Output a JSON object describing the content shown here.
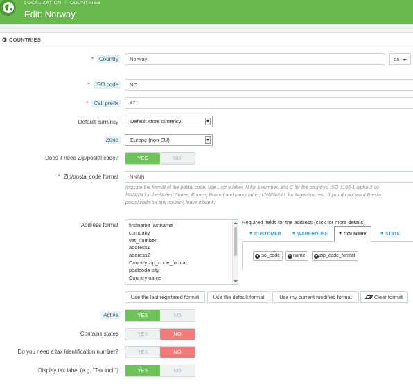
{
  "header": {
    "breadcrumb": [
      "LOCALIZATION",
      "COUNTRIES"
    ],
    "title": "Edit: Norway",
    "accent_color": "#6ab94e"
  },
  "panel": {
    "title": "COUNTRIES"
  },
  "form": {
    "country": {
      "label": "Country",
      "value": "Norway",
      "lang": "da"
    },
    "iso_code": {
      "label": "ISO code",
      "value": "NO"
    },
    "call_prefix": {
      "label": "Call prefix",
      "value": "47"
    },
    "default_currency": {
      "label": "Default currency",
      "selected": "Default store currency"
    },
    "zone": {
      "label": "Zone",
      "selected": "Europe (non-EU)"
    },
    "need_zip": {
      "label": "Does it need Zip/postal code?",
      "yes": "YES",
      "no": "NO",
      "value": "yes"
    },
    "zip_format": {
      "label": "Zip/postal code format",
      "value": "NNNN",
      "help_lines": [
        "Indicate the format of the postal code: use L for a letter, N for a number, and C for the country's ISO 3166-1 alpha-2 co",
        "NNNNN for the United States, France, Poland and many other; LNNNNLLL for Argentina, etc. If you do not want Presta",
        "postal code for this country, leave it blank."
      ]
    },
    "address_format": {
      "label": "Address format",
      "lines": [
        "firstname lastname",
        "company",
        "vat_number",
        "address1",
        "address2",
        "Country:zip_code_format",
        "postcode city",
        "Country:name"
      ],
      "required_title": "Required fields for the address (click for more details)",
      "tabs": [
        "CUSTOMER",
        "WAREHOUSE",
        "COUNTRY",
        "STATE"
      ],
      "active_tab": "COUNTRY",
      "field_buttons": [
        "iso_code",
        "name",
        "zip_code_format"
      ],
      "buttons": {
        "last_registered": "Use the last registered format",
        "default": "Use the default format",
        "current_modified": "Use my current modified format",
        "clear": "Clear format"
      }
    },
    "active": {
      "label": "Active",
      "yes": "YES",
      "no": "NO",
      "value": "yes"
    },
    "contains_states": {
      "label": "Contains states",
      "yes": "YES",
      "no": "NO",
      "value": "no"
    },
    "need_tax_id": {
      "label": "Do you need a tax identification number?",
      "yes": "YES",
      "no": "NO",
      "value": "no"
    },
    "display_tax_label": {
      "label": "Display tax label (e.g. \"Tax incl.\")",
      "yes": "YES",
      "no": "NO",
      "value": "yes"
    }
  }
}
